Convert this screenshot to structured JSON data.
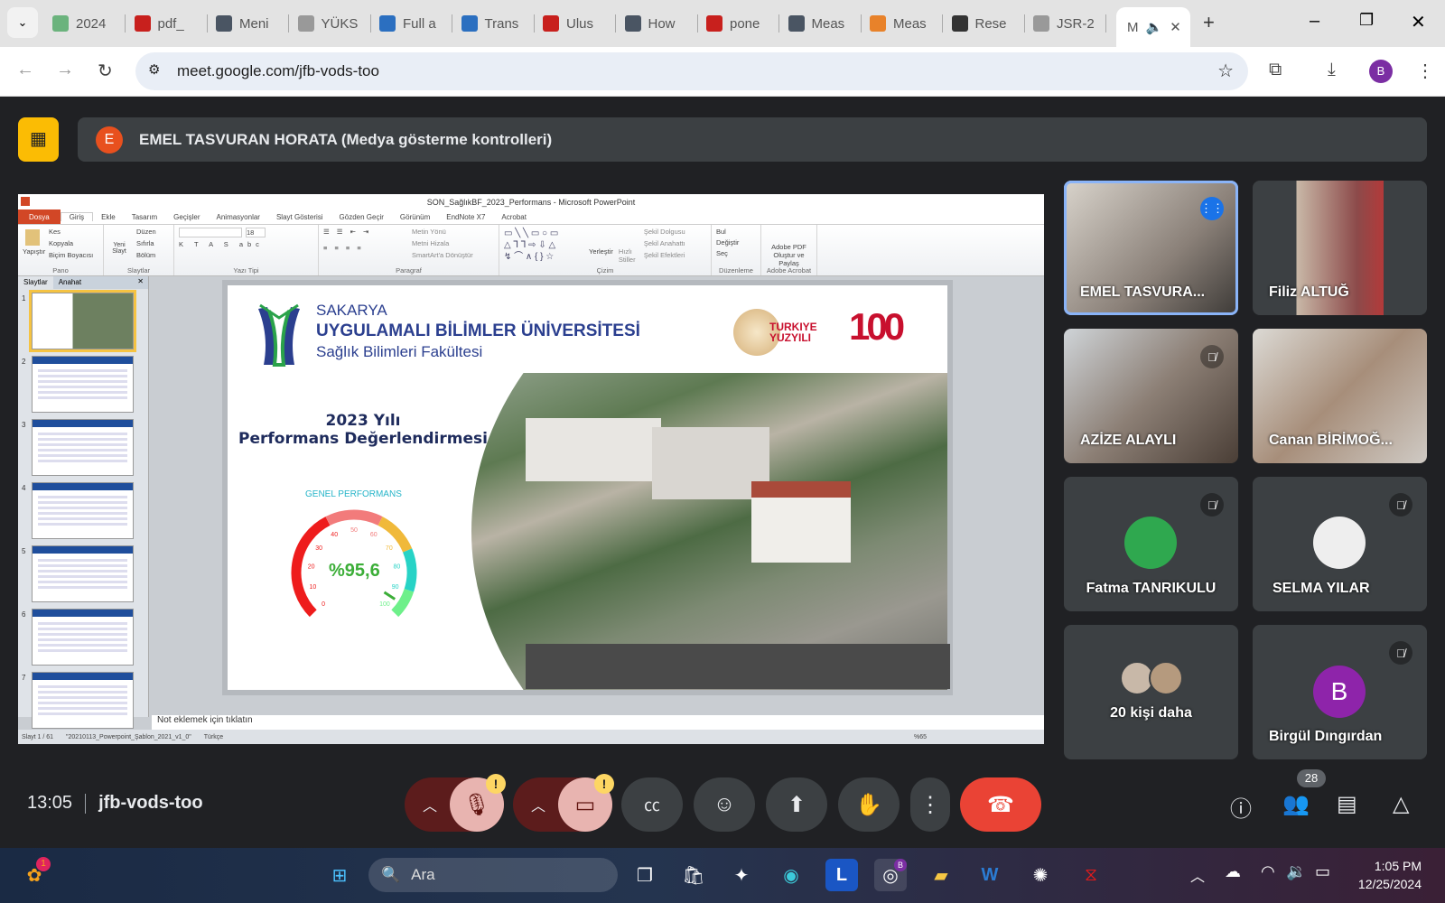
{
  "browser": {
    "tabs": [
      {
        "label": "2024",
        "color": "#6bb37d"
      },
      {
        "label": "pdf_",
        "color": "#c8201d"
      },
      {
        "label": "Meni",
        "color": "#4a5563"
      },
      {
        "label": "YÜKS",
        "color": "#999999"
      },
      {
        "label": "Full a",
        "color": "#2b6fc0"
      },
      {
        "label": "Trans",
        "color": "#2b6fc0"
      },
      {
        "label": "Ulus",
        "color": "#c8201d"
      },
      {
        "label": "How",
        "color": "#4a5563"
      },
      {
        "label": "pone",
        "color": "#c8201d"
      },
      {
        "label": "Meas",
        "color": "#4a5563"
      },
      {
        "label": "Meas",
        "color": "#e8822a"
      },
      {
        "label": "Rese",
        "color": "#333333"
      },
      {
        "label": "JSR-2",
        "color": "#999999"
      }
    ],
    "active_tab": "M",
    "url": "meet.google.com/jfb-vods-too",
    "profile_initial": "B"
  },
  "meet": {
    "presenter_initial": "E",
    "presenter_banner": "EMEL TASVURAN HORATA (Medya gösterme kontrolleri)",
    "participants": [
      {
        "name": "EMEL TASVURA...",
        "speaking": true
      },
      {
        "name": "Filiz ALTUĞ"
      },
      {
        "name": "AZİZE ALAYLI",
        "muted": true
      },
      {
        "name": "Canan BİRİMOĞ..."
      },
      {
        "name": "Fatma TANRIKULU",
        "muted": true
      },
      {
        "name": "SELMA YILAR",
        "muted": true
      },
      {
        "name": "20 kişi daha"
      },
      {
        "name": "Birgül Dıngırdan",
        "initial": "B",
        "muted": true
      }
    ],
    "time": "13:05",
    "meeting_code": "jfb-vods-too",
    "people_count": "28",
    "warn": "!"
  },
  "ppt": {
    "title": "SON_SağlıkBF_2023_Performans - Microsoft PowerPoint",
    "tabs": [
      "Dosya",
      "Giriş",
      "Ekle",
      "Tasarım",
      "Geçişler",
      "Animasyonlar",
      "Slayt Gösterisi",
      "Gözden Geçir",
      "Görünüm",
      "EndNote X7",
      "Acrobat"
    ],
    "groups": {
      "pano": {
        "label": "Pano",
        "paste": "Yapıştır",
        "items": [
          "Kes",
          "Kopyala",
          "Biçim Boyacısı"
        ]
      },
      "slaytlar": {
        "label": "Slaytlar",
        "new": "Yeni Slayt",
        "items": [
          "Düzen",
          "Sıfırla",
          "Bölüm"
        ]
      },
      "yazi": {
        "label": "Yazı Tipi",
        "size": "18"
      },
      "paragraf": {
        "label": "Paragraf",
        "items": [
          "Metin Yönü",
          "Metni Hizala",
          "SmartArt'a Dönüştür"
        ]
      },
      "cizim": {
        "label": "Çizim",
        "arrange": "Yerleştir",
        "quick": "Hızlı Stiller",
        "items": [
          "Şekil Dolgusu",
          "Şekil Anahattı",
          "Şekil Efektleri"
        ]
      },
      "duzenleme": {
        "label": "Düzenleme",
        "items": [
          "Bul",
          "Değiştir",
          "Seç"
        ]
      },
      "acrobat": {
        "label": "Adobe Acrobat",
        "item": "Adobe PDF Oluştur ve Paylaş"
      }
    },
    "pane_tabs": [
      "Slaytlar",
      "Anahat"
    ],
    "thumb_numbers": [
      "1",
      "2",
      "3",
      "4",
      "5",
      "6",
      "7"
    ],
    "notes": "Not eklemek için tıklatın",
    "status": {
      "slide": "Slayt 1 / 61",
      "theme": "\"20210113_Powerpoint_Şablon_2021_v1_0\"",
      "lang": "Türkçe",
      "zoom": "%65"
    },
    "slide": {
      "uni1": "SAKARYA",
      "uni2": "UYGULAMALI BİLİMLER ÜNİVERSİTESİ",
      "uni3": "Sağlık Bilimleri Fakültesi",
      "logo_text": [
        "TURKIYE",
        "YUZYILI",
        "100"
      ],
      "year": "2023 Yılı",
      "heading": "Performans Değerlendirmesi",
      "gauge_title": "GENEL PERFORMANS",
      "gauge_value_text": "%95,6",
      "gauge_value": 95.6,
      "gauge_ticks": [
        "0",
        "10",
        "20",
        "30",
        "40",
        "50",
        "60",
        "70",
        "80",
        "90",
        "100"
      ]
    }
  },
  "taskbar": {
    "search": "Ara",
    "time": "1:05 PM",
    "date": "12/25/2024",
    "badge": "1",
    "chrome_badge": "B"
  }
}
